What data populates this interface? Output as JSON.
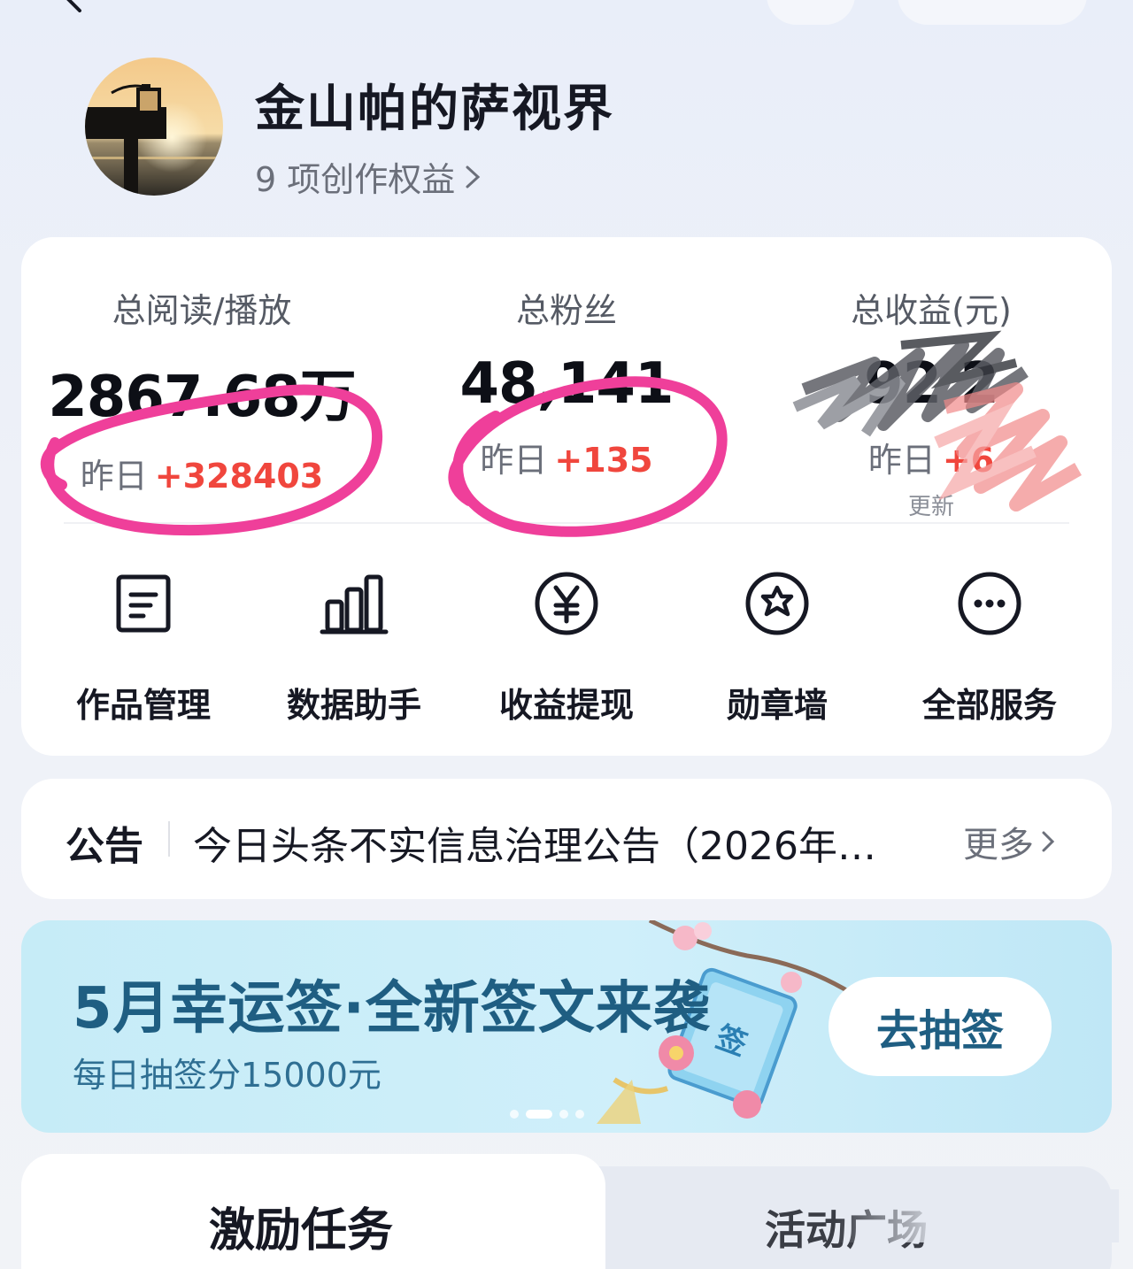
{
  "header": {
    "back_icon": "chevron-left-icon"
  },
  "profile": {
    "name": "金山帕的萨视界",
    "rights_link": "9 项创作权益",
    "avatar_icon": "sunset-pier-avatar"
  },
  "stats": {
    "reads": {
      "label": "总阅读/播放",
      "value": "2867.68万",
      "yesterday_label": "昨日",
      "yesterday_delta": "+328403"
    },
    "fans": {
      "label": "总粉丝",
      "value": "48,141",
      "yesterday_label": "昨日",
      "yesterday_delta": "+135"
    },
    "income": {
      "label": "总收益(元)",
      "value": "92 2",
      "yesterday_label": "昨日",
      "yesterday_delta": "+6",
      "update_note": "更新"
    }
  },
  "services": [
    {
      "label": "作品管理",
      "icon": "document-icon"
    },
    {
      "label": "数据助手",
      "icon": "bar-chart-icon"
    },
    {
      "label": "收益提现",
      "icon": "yen-icon"
    },
    {
      "label": "勋章墙",
      "icon": "medal-icon"
    },
    {
      "label": "全部服务",
      "icon": "more-icon"
    }
  ],
  "notice": {
    "tag": "公告",
    "text": "今日头条不实信息治理公告（2026年…",
    "more": "更多"
  },
  "banner": {
    "title": "5月幸运签·全新签文来袭",
    "subtitle": "每日抽签分15000元",
    "button": "去抽签",
    "pages": 4,
    "active_page": 2
  },
  "tabs": [
    {
      "label": "激励任务",
      "active": true
    },
    {
      "label": "活动广场",
      "active": false
    }
  ],
  "colors": {
    "accent_red": "#f0463d",
    "banner_text": "#1f5e82",
    "annotation_pink": "#ef3f9a"
  }
}
